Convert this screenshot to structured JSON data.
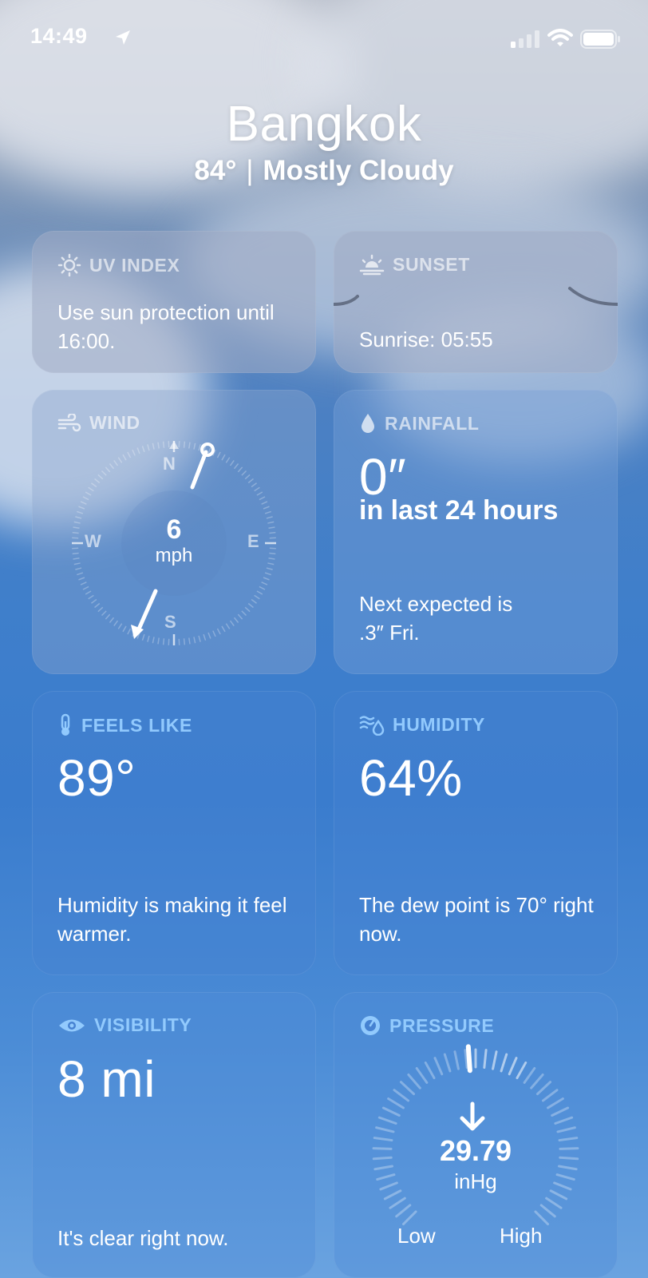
{
  "status_bar": {
    "time": "14:49",
    "icons": [
      "location-arrow-icon",
      "cellular-signal-icon",
      "wifi-icon",
      "battery-icon"
    ]
  },
  "header": {
    "city": "Bangkok",
    "temperature": "84°",
    "separator": "|",
    "condition": "Mostly Cloudy"
  },
  "cards": {
    "uv_index": {
      "title": "UV INDEX",
      "icon": "sun-icon",
      "text": "Use sun protection until 16:00."
    },
    "sunset": {
      "title": "SUNSET",
      "icon": "sunset-icon",
      "sunrise_text": "Sunrise: 05:55"
    },
    "wind": {
      "title": "WIND",
      "icon": "wind-icon",
      "speed": "6",
      "unit": "mph",
      "compass": {
        "n": "N",
        "e": "E",
        "s": "S",
        "w": "W"
      }
    },
    "rainfall": {
      "title": "RAINFALL",
      "icon": "raindrop-icon",
      "value": "0″",
      "period": "in last 24 hours",
      "next_line1": "Next expected is",
      "next_line2": ".3″ Fri."
    },
    "feels_like": {
      "title": "FEELS LIKE",
      "icon": "thermometer-icon",
      "value": "89°",
      "text": "Humidity is making it feel warmer."
    },
    "humidity": {
      "title": "HUMIDITY",
      "icon": "humidity-icon",
      "value": "64%",
      "text": "The dew point is 70° right now."
    },
    "visibility": {
      "title": "VISIBILITY",
      "icon": "eye-icon",
      "value": "8 mi",
      "text": "It's clear right now."
    },
    "pressure": {
      "title": "PRESSURE",
      "icon": "gauge-icon",
      "value": "29.79",
      "unit": "inHg",
      "low_label": "Low",
      "high_label": "High"
    }
  },
  "colors": {
    "card_title": "#a9c9f0",
    "text": "#ffffff"
  }
}
